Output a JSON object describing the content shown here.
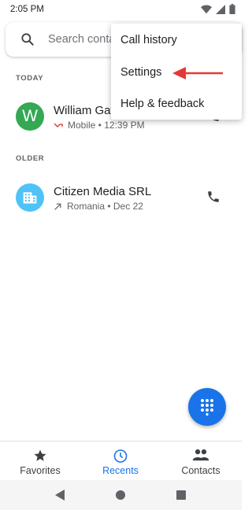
{
  "status_bar": {
    "time": "2:05 PM",
    "icons": [
      "wifi-icon",
      "signal-icon",
      "battery-icon"
    ]
  },
  "search": {
    "placeholder": "Search contacts & places",
    "icon": "search-icon"
  },
  "sections": {
    "today": "TODAY",
    "older": "OLDER"
  },
  "calls": [
    {
      "name": "William Gates",
      "avatar_letter": "W",
      "avatar_color": "#34a853",
      "call_type_icon": "missed-call-icon",
      "detail": "Mobile • 12:39 PM"
    },
    {
      "name": "Citizen Media SRL",
      "avatar_icon": "business-icon",
      "avatar_color": "#4fc3f7",
      "call_type_icon": "outgoing-call-icon",
      "detail": "Romania • Dec 22"
    }
  ],
  "menu": {
    "items": [
      "Call history",
      "Settings",
      "Help & feedback"
    ],
    "highlight_arrow_color": "#e53935"
  },
  "fab": {
    "icon": "dialpad-icon",
    "color": "#1a73e8"
  },
  "bottom_nav": {
    "tabs": [
      {
        "label": "Favorites",
        "icon": "star-icon",
        "active": false
      },
      {
        "label": "Recents",
        "icon": "clock-icon",
        "active": true
      },
      {
        "label": "Contacts",
        "icon": "people-icon",
        "active": false
      }
    ],
    "active_color": "#1a73e8",
    "inactive_color": "#3c4043"
  },
  "system_nav": [
    "back-icon",
    "home-icon",
    "overview-icon"
  ]
}
